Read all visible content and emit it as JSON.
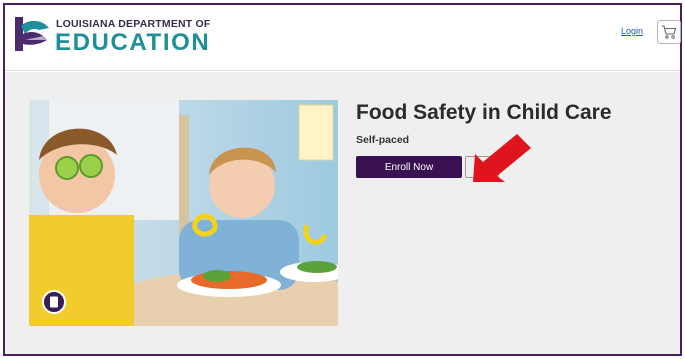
{
  "header": {
    "logo_line1": "LOUISIANA DEPARTMENT OF",
    "logo_line2": "EDUCATION",
    "login_label": "Login",
    "cart_icon": "shopping-cart-icon"
  },
  "course": {
    "title": "Food Safety in Child Care",
    "pace": "Self-paced",
    "enroll_label": "Enroll Now",
    "badge_icon": "document-icon"
  },
  "colors": {
    "frame": "#4b1f5e",
    "brand_teal": "#1f8f99",
    "enroll_button": "#3a1150",
    "arrow": "#e0141c"
  }
}
